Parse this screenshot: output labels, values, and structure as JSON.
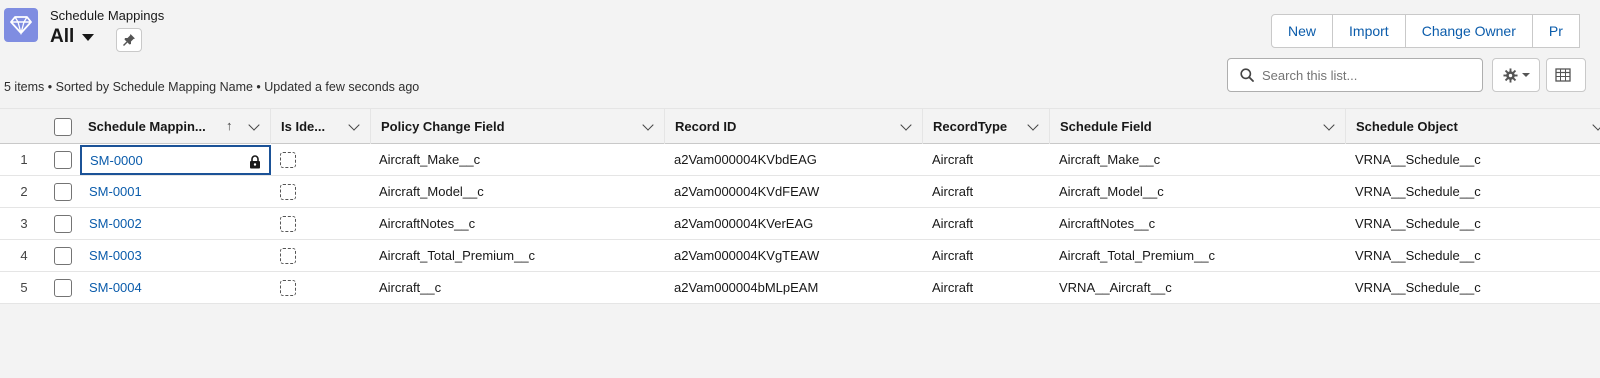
{
  "header": {
    "object_label": "Schedule Mappings",
    "view_name": "All",
    "meta": "5 items • Sorted by Schedule Mapping Name • Updated a few seconds ago",
    "buttons": [
      "New",
      "Import",
      "Change Owner",
      "Pr"
    ],
    "search_placeholder": "Search this list..."
  },
  "icons": {
    "object": "diamond-icon",
    "pin": "pin-icon",
    "search": "search-icon",
    "settings": "gear-icon",
    "table_view": "table-icon",
    "lock": "lock-icon"
  },
  "colors": {
    "accent": "#0b5cab",
    "object_icon_bg": "#7f8de1",
    "focus_border": "#1b5297"
  },
  "table": {
    "columns": [
      "Schedule Mappin...",
      "Is Ide...",
      "Policy Change Field",
      "Record ID",
      "RecordType",
      "Schedule Field",
      "Schedule Object"
    ],
    "rows": [
      {
        "num": "1",
        "name": "SM-0000",
        "policy_field": "Aircraft_Make__c",
        "record_id": "a2Vam000004KVbdEAG",
        "record_type": "Aircraft",
        "schedule_field": "Aircraft_Make__c",
        "schedule_object": "VRNA__Schedule__c"
      },
      {
        "num": "2",
        "name": "SM-0001",
        "policy_field": "Aircraft_Model__c",
        "record_id": "a2Vam000004KVdFEAW",
        "record_type": "Aircraft",
        "schedule_field": "Aircraft_Model__c",
        "schedule_object": "VRNA__Schedule__c"
      },
      {
        "num": "3",
        "name": "SM-0002",
        "policy_field": "AircraftNotes__c",
        "record_id": "a2Vam000004KVerEAG",
        "record_type": "Aircraft",
        "schedule_field": "AircraftNotes__c",
        "schedule_object": "VRNA__Schedule__c"
      },
      {
        "num": "4",
        "name": "SM-0003",
        "policy_field": "Aircraft_Total_Premium__c",
        "record_id": "a2Vam000004KVgTEAW",
        "record_type": "Aircraft",
        "schedule_field": "Aircraft_Total_Premium__c",
        "schedule_object": "VRNA__Schedule__c"
      },
      {
        "num": "5",
        "name": "SM-0004",
        "policy_field": "Aircraft__c",
        "record_id": "a2Vam000004bMLpEAM",
        "record_type": "Aircraft",
        "schedule_field": "VRNA__Aircraft__c",
        "schedule_object": "VRNA__Schedule__c"
      }
    ]
  }
}
